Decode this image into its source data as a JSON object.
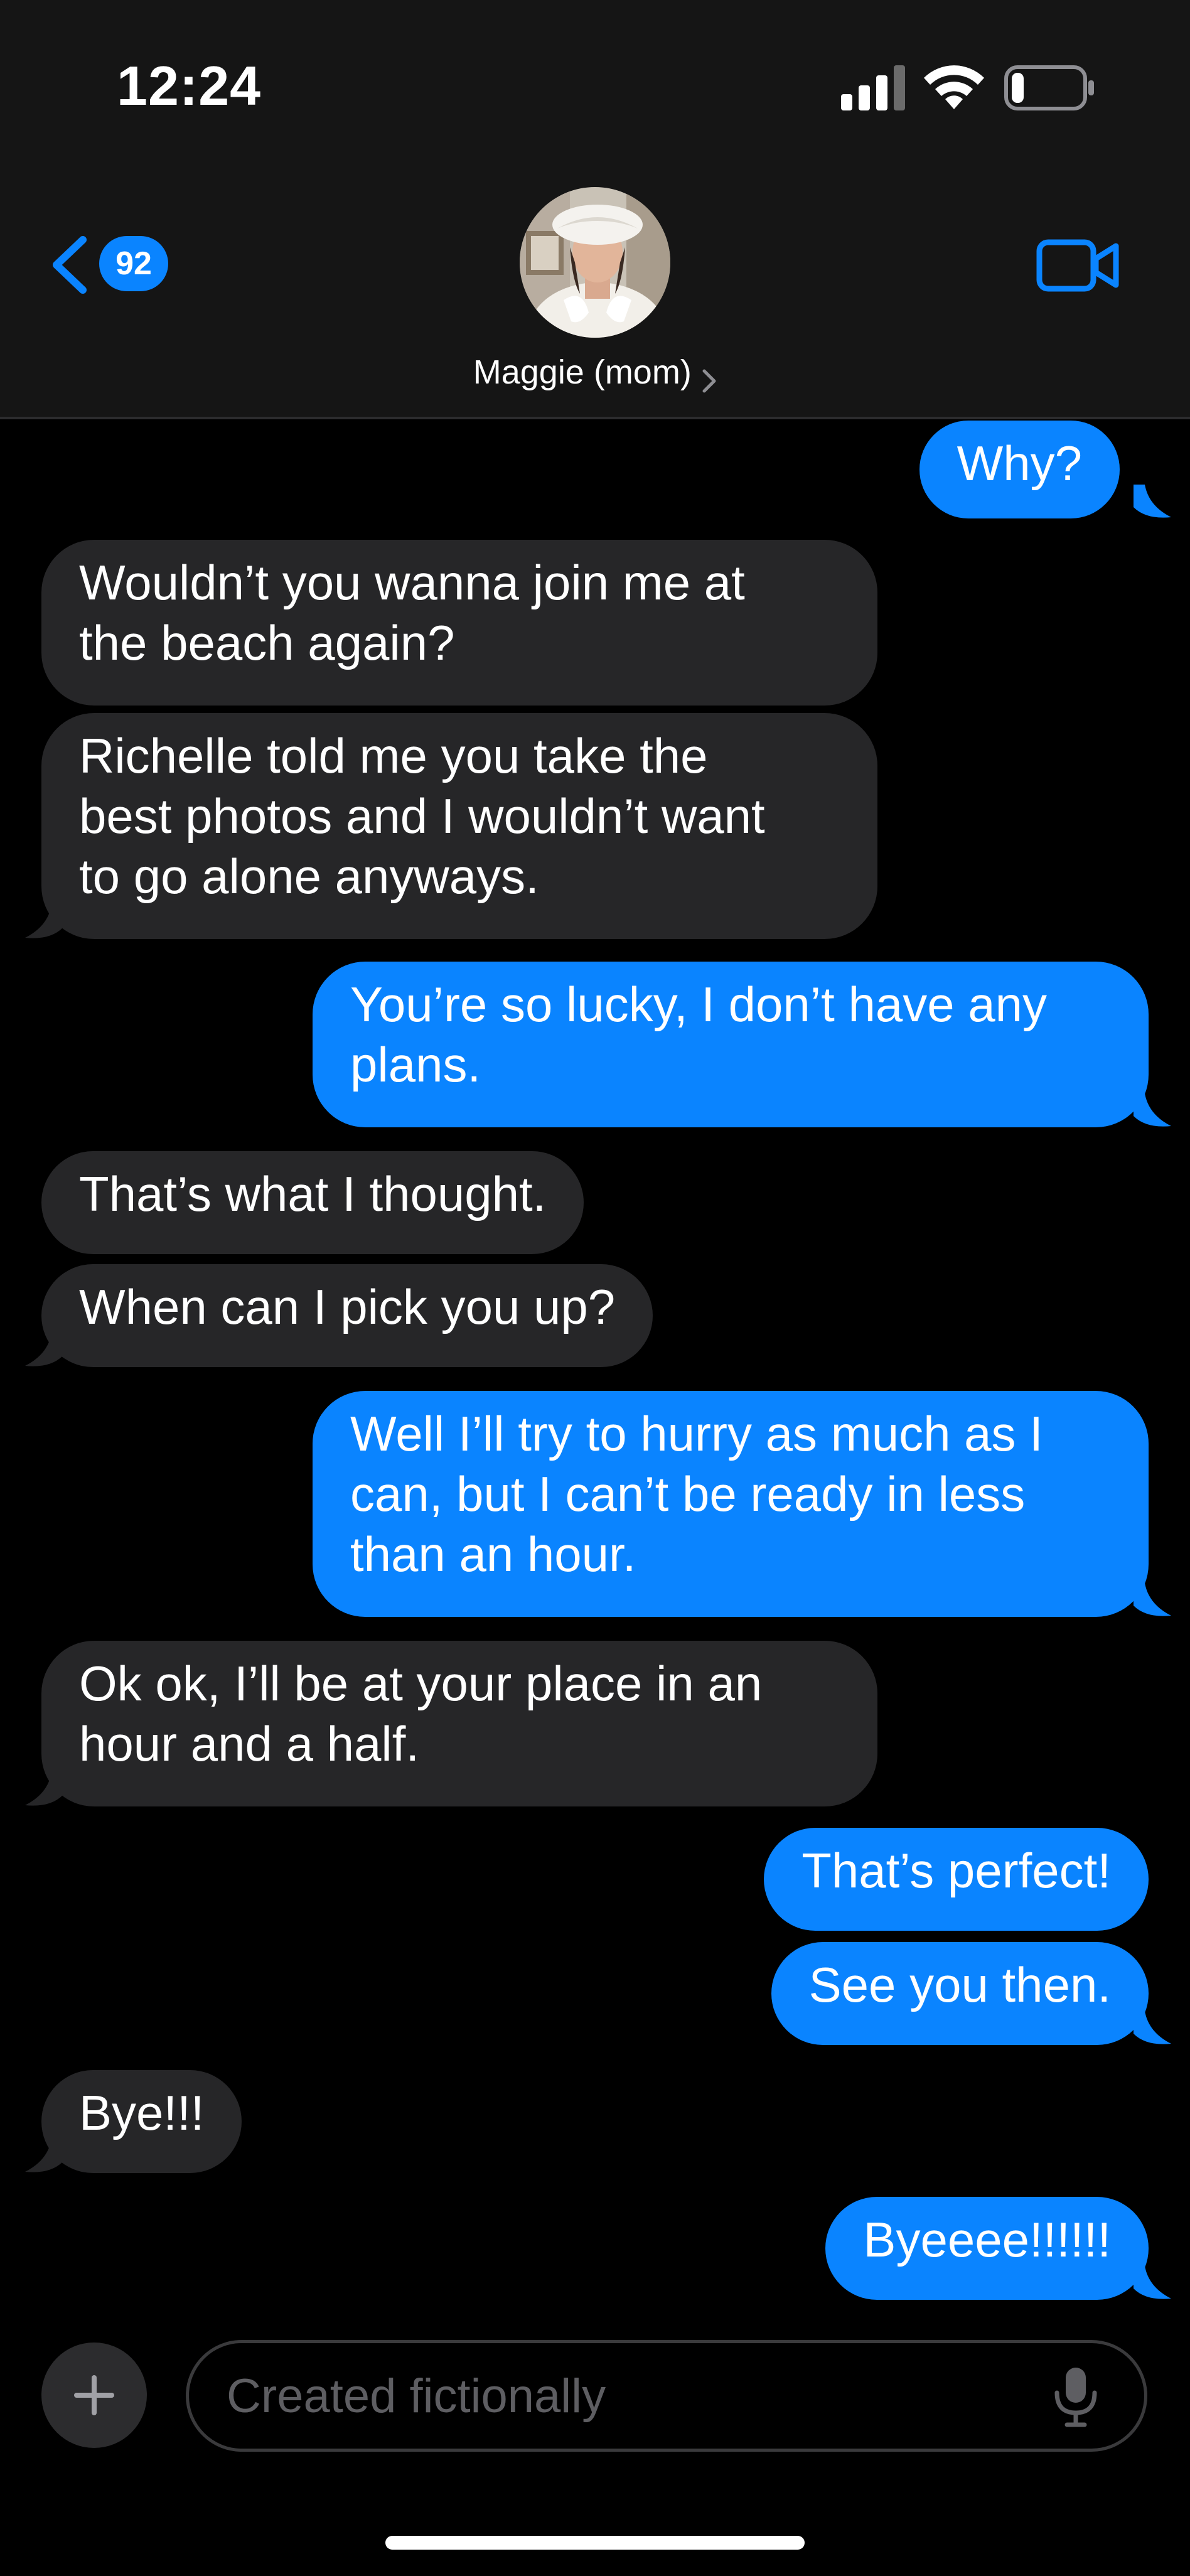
{
  "status_bar": {
    "time": "12:24",
    "battery_level": 0.18
  },
  "header": {
    "unread_count": "92",
    "contact_name": "Maggie (mom)"
  },
  "icons": {
    "back": "chevron-left-icon",
    "video": "video-camera-icon",
    "add": "plus-icon",
    "mic": "microphone-icon"
  },
  "colors": {
    "sent_bubble": "#0a84ff",
    "received_bubble": "#262628",
    "header_bg": "#151515",
    "background": "#000000"
  },
  "messages": [
    {
      "from": "me",
      "text": "Why?",
      "tail": true
    },
    {
      "from": "them",
      "text": "Wouldn’t you wanna join me at\nthe beach again?",
      "tail": false
    },
    {
      "from": "them",
      "text": "Richelle told me you take the\nbest photos and I wouldn’t want\nto go alone anyways.",
      "tail": true
    },
    {
      "from": "me",
      "text": "You’re so lucky, I don’t have any\nplans.",
      "tail": true
    },
    {
      "from": "them",
      "text": "That’s what I thought.",
      "tail": false
    },
    {
      "from": "them",
      "text": "When can I pick you up?",
      "tail": true
    },
    {
      "from": "me",
      "text": "Well I’ll try to hurry as much as I\ncan, but I can’t be ready in less\nthan an hour.",
      "tail": true
    },
    {
      "from": "them",
      "text": "Ok ok, I’ll be at your place in an\nhour and a half.",
      "tail": true
    },
    {
      "from": "me",
      "text": "That’s perfect!",
      "tail": false
    },
    {
      "from": "me",
      "text": "See you then.",
      "tail": true
    },
    {
      "from": "them",
      "text": "Bye!!!",
      "tail": true
    },
    {
      "from": "me",
      "text": "Byeeee!!!!!!",
      "tail": true
    }
  ],
  "composer": {
    "placeholder": "Created fictionally"
  }
}
